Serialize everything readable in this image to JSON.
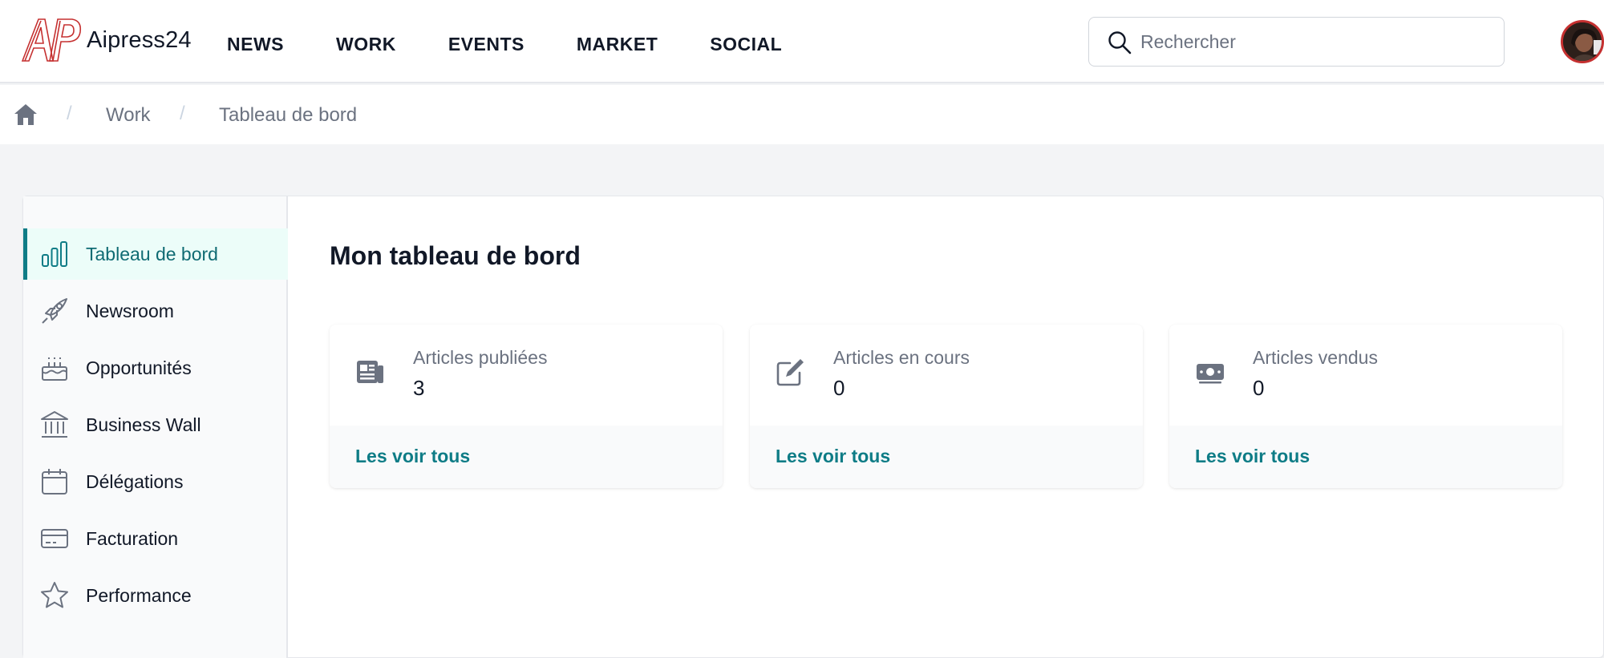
{
  "header": {
    "brand": "Aipress24",
    "logo_icon": "ap-logo-icon",
    "nav": [
      {
        "label": "NEWS"
      },
      {
        "label": "WORK"
      },
      {
        "label": "EVENTS"
      },
      {
        "label": "MARKET"
      },
      {
        "label": "SOCIAL"
      }
    ],
    "search": {
      "placeholder": "Rechercher",
      "value": "",
      "icon": "search-icon"
    },
    "avatar_icon": "user-avatar"
  },
  "breadcrumb": {
    "home_icon": "home-icon",
    "separator": "/",
    "items": [
      {
        "label": "Work"
      },
      {
        "label": "Tableau de bord"
      }
    ]
  },
  "sidebar": {
    "items": [
      {
        "label": "Tableau de bord",
        "icon": "bar-chart-icon",
        "active": true
      },
      {
        "label": "Newsroom",
        "icon": "rocket-icon",
        "active": false
      },
      {
        "label": "Opportunités",
        "icon": "cake-icon",
        "active": false
      },
      {
        "label": "Business Wall",
        "icon": "bank-icon",
        "active": false
      },
      {
        "label": "Délégations",
        "icon": "calendar-icon",
        "active": false
      },
      {
        "label": "Facturation",
        "icon": "credit-card-icon",
        "active": false
      },
      {
        "label": "Performance",
        "icon": "star-icon",
        "active": false
      }
    ]
  },
  "main": {
    "title": "Mon tableau de bord",
    "stats": [
      {
        "label": "Articles publiées",
        "value": "3",
        "link": "Les voir tous",
        "icon": "newspaper-icon"
      },
      {
        "label": "Articles en cours",
        "value": "0",
        "link": "Les voir tous",
        "icon": "pencil-icon"
      },
      {
        "label": "Articles vendus",
        "value": "0",
        "link": "Les voir tous",
        "icon": "money-icon"
      }
    ]
  },
  "colors": {
    "accent": "#0e7c86",
    "active_bg": "#ecfdf9",
    "logo_red": "#c53030",
    "page_bg": "#f3f4f6"
  }
}
